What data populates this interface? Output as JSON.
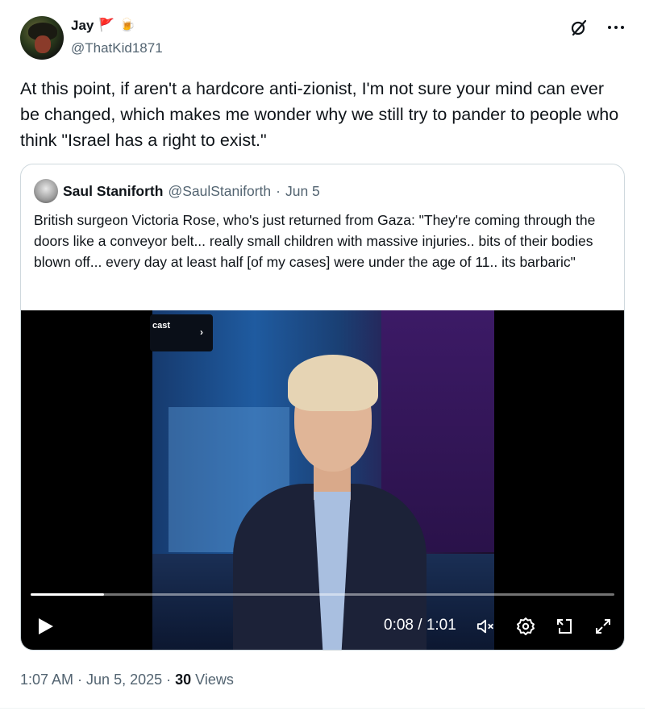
{
  "author": {
    "name": "Jay",
    "emojis": [
      "🚩",
      "🍺"
    ],
    "handle": "@ThatKid1871"
  },
  "tweet": {
    "text": "At this point, if aren't a hardcore anti-zionist, I'm not sure your mind can ever be changed, which makes me wonder why we still try to pander to people who think \"Israel has a right to exist.\""
  },
  "quote": {
    "name": "Saul Staniforth",
    "handle": "@SaulStaniforth",
    "dot": "·",
    "date": "Jun 5",
    "text": "British surgeon Victoria Rose, who's just returned from Gaza: \"They're coming through the doors like a conveyor belt... really small children with massive injuries.. bits of their bodies blown off... every day at least half [of my cases] were under the age of 11.. its barbaric\""
  },
  "video": {
    "cast_label": "cast",
    "chevron": "›",
    "time": "0:08 / 1:01",
    "progress_fraction": 0.125,
    "icons": [
      "play-icon",
      "mute-icon",
      "settings-icon",
      "pip-icon",
      "fullscreen-icon"
    ]
  },
  "footer": {
    "time": "1:07 AM",
    "dot1": "·",
    "date": "Jun 5, 2025",
    "dot2": "·",
    "views_count": "30",
    "views_label": "Views"
  },
  "colors": {
    "text": "#0f1419",
    "secondary": "#536471",
    "border": "#cfd9de"
  }
}
